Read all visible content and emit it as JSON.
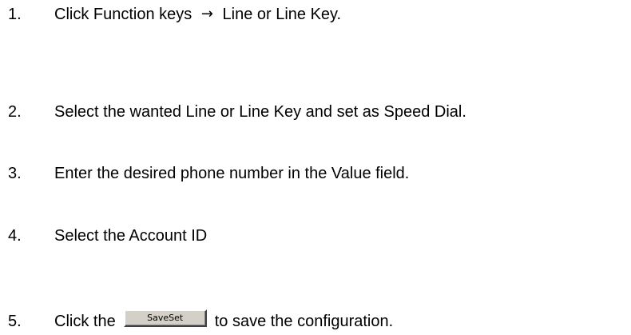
{
  "steps": [
    {
      "number": "1.",
      "text_before": "Click Function keys",
      "arrow": "→",
      "text_after": "Line or Line Key."
    },
    {
      "number": "2.",
      "text": "Select the wanted Line or Line Key and set as Speed Dial."
    },
    {
      "number": "3.",
      "text": "Enter the desired phone number in the Value field."
    },
    {
      "number": "4.",
      "text": "Select the Account ID"
    },
    {
      "number": "5.",
      "text_before": "Click the",
      "button_label": "SaveSet",
      "text_after": "to save the configuration."
    }
  ]
}
